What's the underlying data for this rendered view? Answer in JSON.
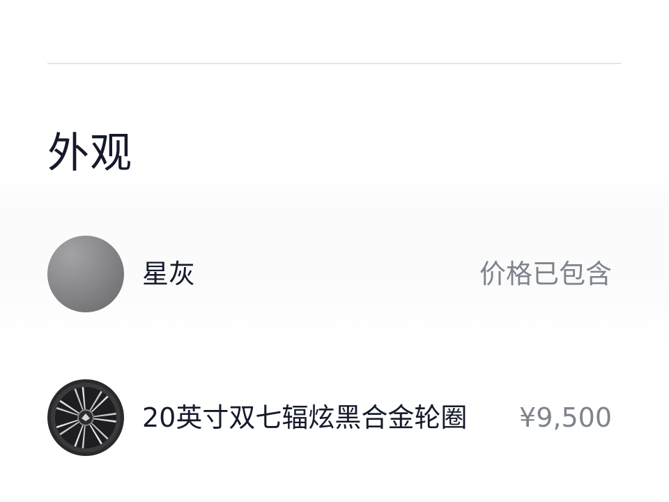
{
  "section": {
    "title": "外观"
  },
  "options": [
    {
      "label": "星灰",
      "price": "价格已包含",
      "swatch_icon": "grey-paint-swatch",
      "swatch_color": "#838386"
    },
    {
      "label": "20英寸双七辐炫黑合金轮圈",
      "price": "¥9,500",
      "swatch_icon": "alloy-wheel-icon"
    }
  ],
  "colors": {
    "text_primary": "#141a2a",
    "text_secondary": "#7e838c",
    "divider": "#e6e6e8"
  }
}
